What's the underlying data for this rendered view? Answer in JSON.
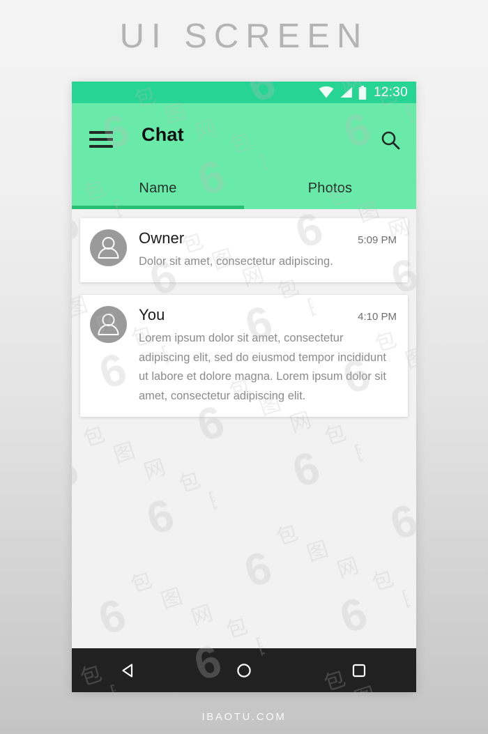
{
  "page": {
    "title": "UI SCREEN",
    "footer": "IBAOTU.COM"
  },
  "colors": {
    "status_bar": "#27d493",
    "app_bar": "#6aeaa9",
    "tab_indicator": "#27bf73",
    "nav_bar": "#212121",
    "screen_bg": "#f2f2f2",
    "card_bg": "#ffffff",
    "avatar": "#9a9a9a",
    "title_text": "#b4b4b4"
  },
  "status_bar": {
    "clock": "12:30",
    "icons": [
      "wifi-icon",
      "signal-icon",
      "battery-icon"
    ]
  },
  "app_bar": {
    "menu_label": "menu-icon",
    "title": "Chat",
    "search_label": "search-icon"
  },
  "tabs": {
    "items": [
      {
        "label": "Name",
        "active": true
      },
      {
        "label": "Photos",
        "active": false
      }
    ]
  },
  "messages": [
    {
      "name": "Owner",
      "time": "5:09 PM",
      "text": "Dolor sit amet, consectetur adipiscing."
    },
    {
      "name": "You",
      "time": "4:10 PM",
      "text": "Lorem ipsum dolor sit amet, consectetur adipiscing elit, sed do eiusmod tempor incididunt ut labore et dolore magna. Lorem ipsum dolor sit amet, consectetur adipiscing elit."
    }
  ],
  "nav_bar": {
    "back": "back-triangle-icon",
    "home": "home-circle-icon",
    "recents": "recents-square-icon"
  },
  "watermark": {
    "text": "包图网"
  }
}
